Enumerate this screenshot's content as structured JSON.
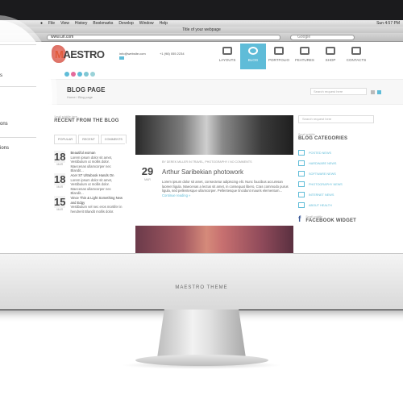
{
  "os_menu": {
    "items": [
      "File",
      "View",
      "History",
      "Bookmarks",
      "Develop",
      "Window",
      "Help"
    ],
    "clock": "Sun 4:57 PM"
  },
  "browser": {
    "title": "Title of your webpage",
    "url": "www.url.com",
    "search_placeholder": "Google"
  },
  "site": {
    "logo_rest": "AESTRO",
    "logo_first": "M",
    "email": "info@website.com",
    "phone": "+1 (98) 055 2234",
    "nav": [
      {
        "label": "LAYOUTS",
        "icon": "layouts-icon"
      },
      {
        "label": "BLOG",
        "icon": "globe-icon"
      },
      {
        "label": "PORTFOLIO",
        "icon": "camera-icon"
      },
      {
        "label": "FEATURES",
        "icon": "features-icon"
      },
      {
        "label": "SHOP",
        "icon": "shop-icon"
      },
      {
        "label": "CONTACTS",
        "icon": "contacts-icon"
      }
    ],
    "accent": "#5fbcd8"
  },
  "page": {
    "title": "BLOG PAGE",
    "breadcrumb": "Home   /   Blog page",
    "search_placeholder": "Search request here"
  },
  "left_sidebar": {
    "subtitle": "Small subtitle here",
    "title": "RECENT FROM THE BLOG",
    "tabs": [
      "POPULAR",
      "RECENT",
      "COMMENTS"
    ],
    "posts": [
      {
        "day": "18",
        "month": "MAR",
        "title": "Beautiful woman",
        "excerpt": "Lorem ipsum dolor sit amet, Vestibulum ut mollis dolor. Maecenas ullamcorper nec Blandit..."
      },
      {
        "day": "18",
        "month": "MAR",
        "title": "Acer S7 Ultrabook Hands On",
        "excerpt": "Lorem ipsum dolor sit amet, Vestibulum ut mollis dolor. Maecenas ullamcorper nec Blandit..."
      },
      {
        "day": "15",
        "month": "MAR",
        "title": "Vince Thin & Light Something New and Edgy",
        "excerpt": "Vestibulum vel nec eros mortifer in hendrerit Blandit mollis dolor."
      }
    ]
  },
  "main_post": {
    "meta": "BY DEREK MILLER IN TRAVEL, PHOTOGRAPHY / NO COMMENTS",
    "day": "29",
    "month": "MAR",
    "title": "Arthur Saribekian photowork",
    "body": "Lorem ipsum dolor sit amet, consectetur adipiscing elit. Nunc faucibus accumsan laoreet ligula. Maecenas a lectus sit amet, in consequat libero, Cras commodo purus ligula, sed pellentesque ullamcorper. Pellentesque tincidunt mauris elementum...",
    "more": "Continue reading »"
  },
  "right_sidebar": {
    "search_placeholder": "Search request here",
    "subtitle": "Small subtitle",
    "title": "BLOG CATEGORIES",
    "categories": [
      "POSTED NEWS",
      "HARDWARE NEWS",
      "SOFTWARE NEWS",
      "PHOTOGRAPHY NEWS",
      "INTERNET NEWS",
      "ABOUT HEALTH"
    ],
    "widget_subtitle": "Small subtitle",
    "widget_title": "FACEBOOK WIDGET"
  },
  "overlay_labels": [
    "s",
    "ons",
    "ions"
  ],
  "monitor_label": "MAESTRO THEME"
}
